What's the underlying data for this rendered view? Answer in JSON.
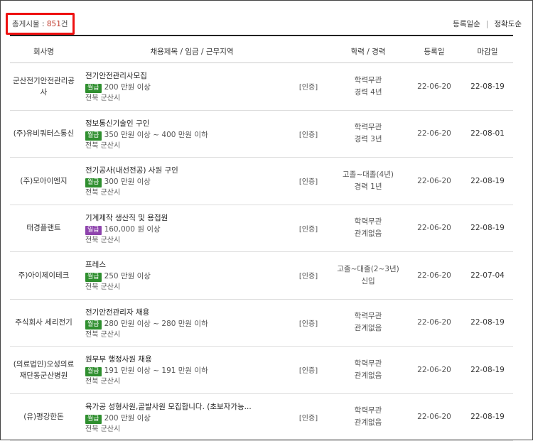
{
  "summary": {
    "label": "총게시물 : ",
    "count": "851",
    "unit": "건"
  },
  "sort": {
    "option1": "등록일순",
    "divider": "|",
    "option2": "정확도순"
  },
  "headers": {
    "company": "회사명",
    "job": "채용제목 / 임금 / 근무지역",
    "edu": "학력 / 경력",
    "registered": "등록일",
    "deadline": "마감일"
  },
  "colors": {
    "monthly_badge": "#2f8f2f",
    "daily_badge": "#8e44ad",
    "highlight_border": "#ee1111",
    "count_text": "#c0392b"
  },
  "rows": [
    {
      "company": "군산전기안전관리공사",
      "title": "전기안전관리사모집",
      "badge": "월급",
      "badge_type": "monthly",
      "wage": "200 만원 이상",
      "region": "전북 군산시",
      "cert": "[인증]",
      "edu": "학력무관",
      "career": "경력 4년",
      "registered": "22-06-20",
      "deadline": "22-08-19"
    },
    {
      "company": "(주)유비쿼터스통신",
      "title": "정보통신기술인 구인",
      "badge": "월급",
      "badge_type": "monthly",
      "wage": "350 만원 이상 ~ 400 만원 이하",
      "region": "전북 군산시",
      "cert": "[인증]",
      "edu": "학력무관",
      "career": "경력 3년",
      "registered": "22-06-20",
      "deadline": "22-08-01"
    },
    {
      "company": "(주)모아이엔지",
      "title": "전기공사(내선전공) 사원 구인",
      "badge": "월급",
      "badge_type": "monthly",
      "wage": "300 만원 이상",
      "region": "전북 군산시",
      "cert": "[인증]",
      "edu": "고졸~대졸(4년)",
      "career": "경력 1년",
      "registered": "22-06-20",
      "deadline": "22-08-19"
    },
    {
      "company": "태경플랜트",
      "title": "기계제작 생산직 및 용접원",
      "badge": "일급",
      "badge_type": "daily",
      "wage": "160,000 원 이상",
      "region": "전북 군산시",
      "cert": "[인증]",
      "edu": "학력무관",
      "career": "관계없음",
      "registered": "22-06-20",
      "deadline": "22-08-19"
    },
    {
      "company": "주)아이제이테크",
      "title": "프레스",
      "badge": "월급",
      "badge_type": "monthly",
      "wage": "250 만원 이상",
      "region": "전북 군산시",
      "cert": "[인증]",
      "edu": "고졸~대졸(2~3년)",
      "career": "신입",
      "registered": "22-06-20",
      "deadline": "22-07-04"
    },
    {
      "company": "주식회사 세리전기",
      "title": "전기안전관리자 채용",
      "badge": "월급",
      "badge_type": "monthly",
      "wage": "280 만원 이상 ~ 280 만원 이하",
      "region": "전북 군산시",
      "cert": "[인증]",
      "edu": "학력무관",
      "career": "관계없음",
      "registered": "22-06-20",
      "deadline": "22-08-19"
    },
    {
      "company": "(의료법인)오성의료재단동군산병원",
      "title": "원무부 행정사원 채용",
      "badge": "월급",
      "badge_type": "monthly",
      "wage": "191 만원 이상 ~ 191 만원 이하",
      "region": "전북 군산시",
      "cert": "[인증]",
      "edu": "학력무관",
      "career": "관계없음",
      "registered": "22-06-20",
      "deadline": "22-08-19"
    },
    {
      "company": "(유)평강한돈",
      "title": "육가공 성형사원,골발사원 모집합니다. (초보자가능...",
      "badge": "월급",
      "badge_type": "monthly",
      "wage": "200 만원 이상",
      "region": "전북 군산시",
      "cert": "[인증]",
      "edu": "학력무관",
      "career": "관계없음",
      "registered": "22-06-20",
      "deadline": "22-08-19"
    }
  ]
}
